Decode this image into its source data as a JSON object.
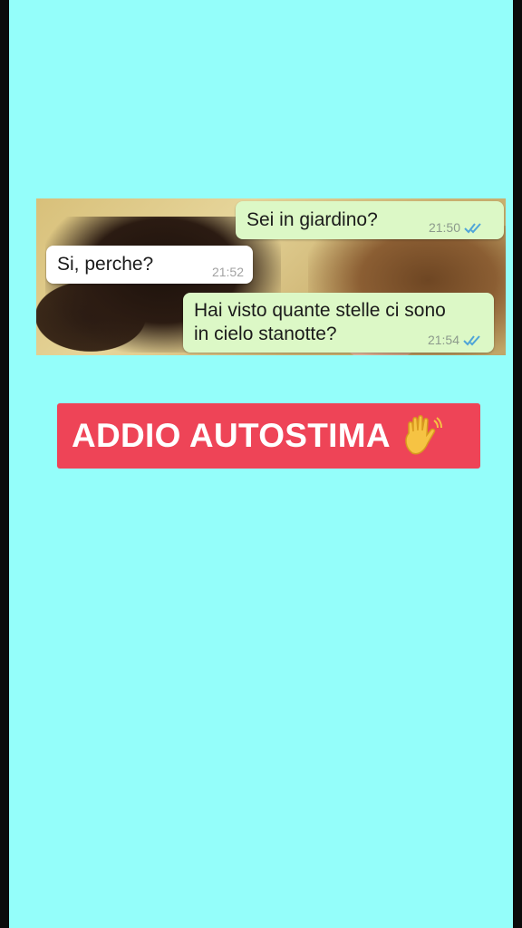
{
  "chat": {
    "messages": [
      {
        "direction": "out",
        "text": "Sei in giardino?",
        "time": "21:50",
        "status": "read"
      },
      {
        "direction": "in",
        "text": "Si, perche?",
        "time": "21:52"
      },
      {
        "direction": "out",
        "text_line1": "Hai visto quante stelle ci sono",
        "text_line2": "in cielo stanotte?",
        "time": "21:54",
        "status": "read"
      }
    ],
    "tick_color": "#4fa5d8",
    "outgoing_bubble_color": "#dcf8c6",
    "incoming_bubble_color": "#ffffff"
  },
  "banner": {
    "text": "ADDIO AUTOSTIMA",
    "emoji_icon": "waving-hand-icon",
    "background_color": "#ee4457"
  },
  "page": {
    "background_color": "#94fefa"
  }
}
